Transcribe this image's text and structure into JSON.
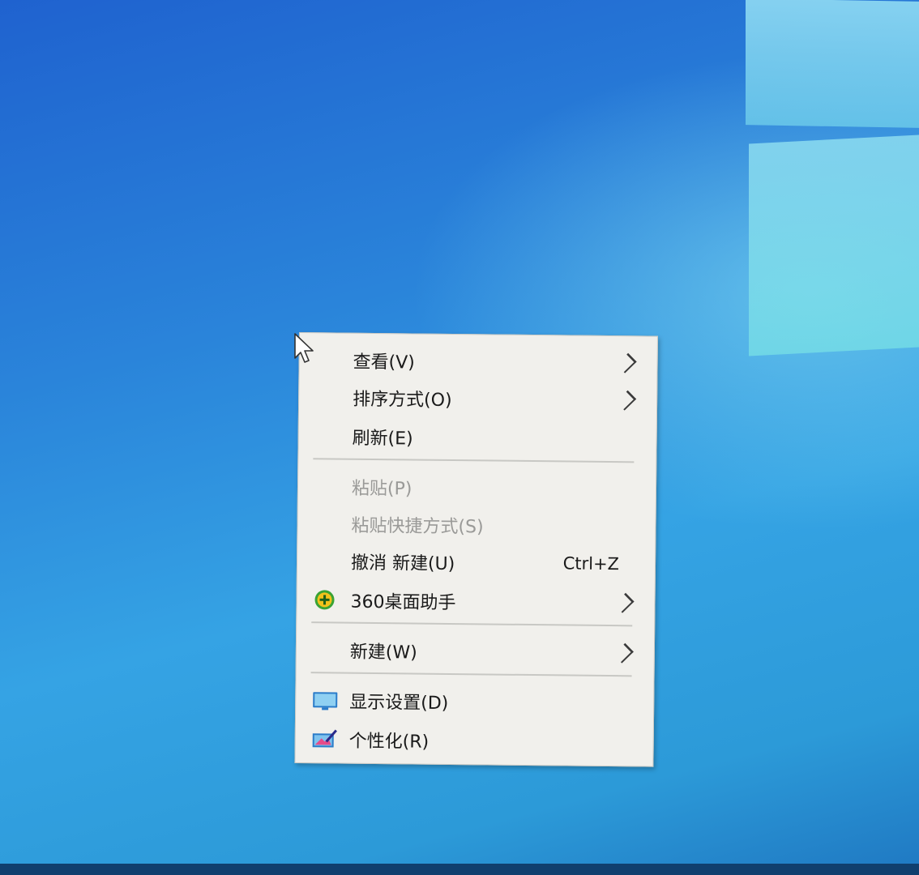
{
  "desktop": {
    "background_colors": [
      "#1f62cf",
      "#35a3e4",
      "#1f78c2"
    ]
  },
  "context_menu": {
    "items": [
      {
        "label": "查看(V)",
        "has_submenu": true,
        "disabled": false
      },
      {
        "label": "排序方式(O)",
        "has_submenu": true,
        "disabled": false
      },
      {
        "label": "刷新(E)",
        "has_submenu": false,
        "disabled": false
      },
      {
        "label": "粘贴(P)",
        "has_submenu": false,
        "disabled": true
      },
      {
        "label": "粘贴快捷方式(S)",
        "has_submenu": false,
        "disabled": true
      },
      {
        "label": "撤消 新建(U)",
        "shortcut": "Ctrl+Z",
        "has_submenu": false,
        "disabled": false
      },
      {
        "label": "360桌面助手",
        "icon": "360-assistant-icon",
        "has_submenu": true,
        "disabled": false
      },
      {
        "label": "新建(W)",
        "has_submenu": true,
        "disabled": false
      },
      {
        "label": "显示设置(D)",
        "icon": "display-settings-icon",
        "has_submenu": false,
        "disabled": false
      },
      {
        "label": "个性化(R)",
        "icon": "personalize-icon",
        "has_submenu": false,
        "disabled": false
      }
    ]
  }
}
